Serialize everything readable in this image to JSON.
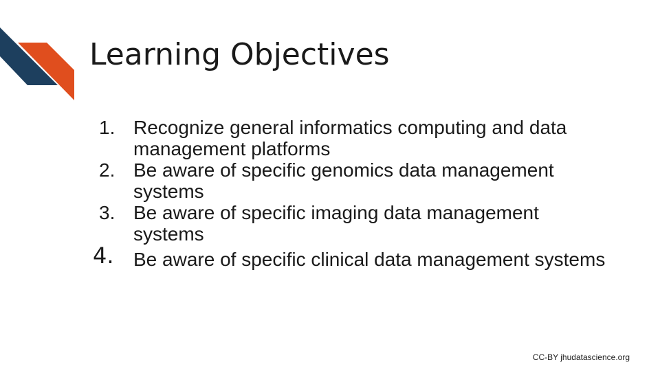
{
  "slide": {
    "title": "Learning Objectives",
    "objectives": [
      {
        "number": "1.",
        "text": "Recognize general informatics computing and data management platforms"
      },
      {
        "number": "2.",
        "text": "Be aware of specific genomics data management systems"
      },
      {
        "number": "3.",
        "text": "Be aware of specific imaging data management systems"
      },
      {
        "number": "4.",
        "text": "Be aware of specific clinical data management systems"
      }
    ],
    "footer": "CC-BY jhudatascience.org"
  },
  "colors": {
    "navy": "#1d3f5e",
    "orange": "#e04e1e",
    "text": "#1a1a1a"
  },
  "icons": {
    "logo": "chevron-stripes-logo"
  }
}
